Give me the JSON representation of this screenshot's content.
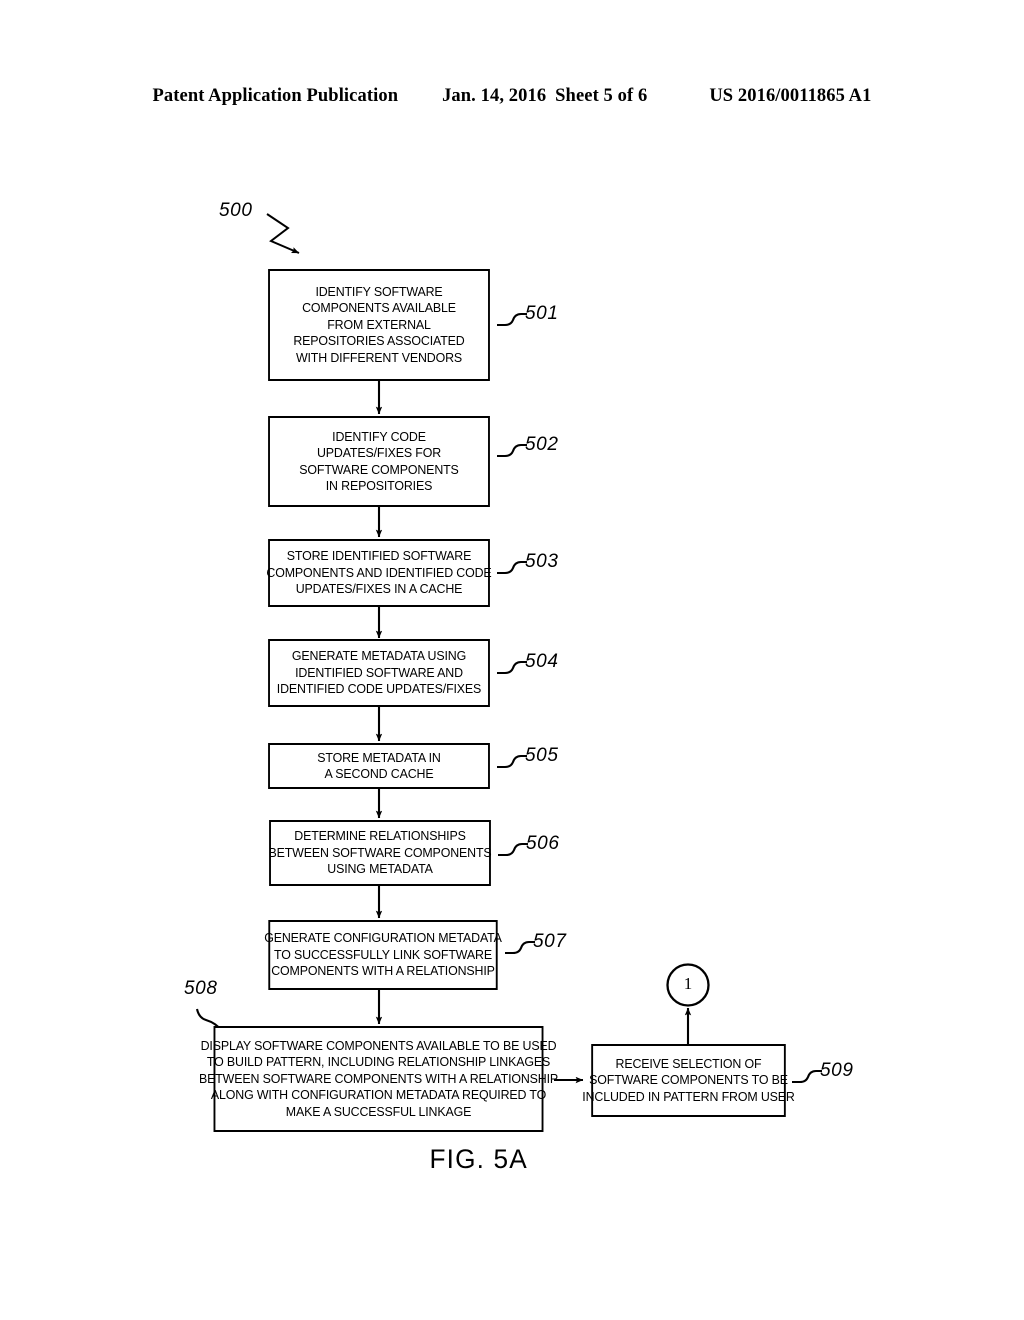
{
  "header": {
    "publication": "Patent Application Publication",
    "date": "Jan. 14, 2016",
    "sheet": "Sheet 5 of 6",
    "patent_number": "US 2016/0011865 A1"
  },
  "figure": {
    "caption": "FIG. 5A",
    "flowchart_ref": "500",
    "connector_label": "1"
  },
  "boxes": [
    {
      "ref": "501",
      "lines": [
        "IDENTIFY SOFTWARE",
        "COMPONENTS AVAILABLE",
        "FROM EXTERNAL",
        "REPOSITORIES ASSOCIATED",
        "WITH DIFFERENT VENDORS"
      ]
    },
    {
      "ref": "502",
      "lines": [
        "IDENTIFY CODE",
        "UPDATES/FIXES FOR",
        "SOFTWARE COMPONENTS",
        "IN REPOSITORIES"
      ]
    },
    {
      "ref": "503",
      "lines": [
        "STORE IDENTIFIED SOFTWARE",
        "COMPONENTS AND IDENTIFIED CODE",
        "UPDATES/FIXES IN A CACHE"
      ]
    },
    {
      "ref": "504",
      "lines": [
        "GENERATE METADATA USING",
        "IDENTIFIED SOFTWARE AND",
        "IDENTIFIED CODE UPDATES/FIXES"
      ]
    },
    {
      "ref": "505",
      "lines": [
        "STORE METADATA IN",
        "A SECOND CACHE"
      ]
    },
    {
      "ref": "506",
      "lines": [
        "DETERMINE RELATIONSHIPS",
        "BETWEEN SOFTWARE COMPONENTS",
        "USING METADATA"
      ]
    },
    {
      "ref": "507",
      "lines": [
        "GENERATE CONFIGURATION METADATA",
        "TO SUCCESSFULLY LINK SOFTWARE",
        "COMPONENTS WITH A RELATIONSHIP"
      ]
    },
    {
      "ref": "508",
      "lines": [
        "DISPLAY SOFTWARE COMPONENTS AVAILABLE TO BE USED",
        "TO BUILD PATTERN, INCLUDING RELATIONSHIP LINKAGES",
        "BETWEEN SOFTWARE COMPONENTS WITH A RELATIONSHIP",
        "ALONG WITH CONFIGURATION METADATA REQUIRED TO",
        "MAKE A SUCCESSFUL LINKAGE"
      ]
    },
    {
      "ref": "509",
      "lines": [
        "RECEIVE SELECTION OF",
        "SOFTWARE COMPONENTS TO BE",
        "INCLUDED IN PATTERN FROM USER"
      ]
    }
  ]
}
